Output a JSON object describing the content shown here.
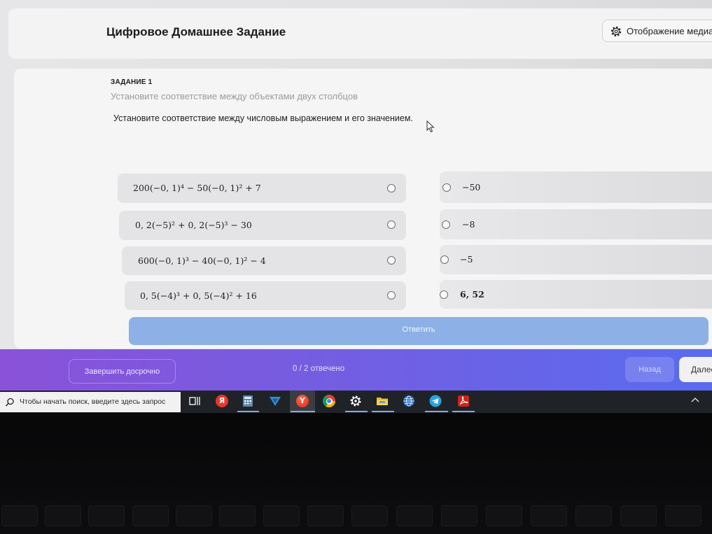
{
  "app": {
    "title": "Цифровое Домашнее Задание",
    "media_button_label": "Отображение медиа",
    "media_button_icon": "gear-icon"
  },
  "task": {
    "number_label": "ЗАДАНИЕ 1",
    "type_hint": "Установите соответствие между объектами двух столбцов",
    "question": "Установите соответствие между числовым выражением и его значением."
  },
  "left_items": [
    {
      "expression": "200(−0, 1)⁴ − 50(−0, 1)² + 7"
    },
    {
      "expression": "0, 2(−5)² + 0, 2(−5)³ − 30"
    },
    {
      "expression": "600(−0, 1)³ − 40(−0, 1)² − 4"
    },
    {
      "expression": "0, 5(−4)³ + 0, 5(−4)² + 16"
    }
  ],
  "right_items": [
    {
      "value": "−50"
    },
    {
      "value": "−8"
    },
    {
      "value": "−5"
    },
    {
      "value": "6, 52"
    }
  ],
  "answer_button_label": "Ответить",
  "footer": {
    "finish_early_label": "Завершить досрочно",
    "progress_text": "0 / 2 отвечено",
    "back_label": "Назад",
    "next_label": "Далее"
  },
  "taskbar": {
    "search_placeholder": "Чтобы начать поиск, введите здесь запрос",
    "apps": [
      {
        "icon": "task-view-icon"
      },
      {
        "icon": "yandex-icon",
        "glyph": "Я"
      },
      {
        "icon": "calculator-icon"
      },
      {
        "icon": "v-app-icon"
      },
      {
        "icon": "yandex-browser-icon",
        "glyph": "Y"
      },
      {
        "icon": "chrome-icon"
      },
      {
        "icon": "settings-icon"
      },
      {
        "icon": "file-explorer-icon"
      },
      {
        "icon": "globe-icon"
      },
      {
        "icon": "telegram-icon"
      },
      {
        "icon": "acrobat-icon"
      }
    ],
    "tray_icon": "chevron-up-icon"
  },
  "colors": {
    "answer_button": "#8db1e6",
    "footer_start": "#8a52d8",
    "footer_end": "#5a6bee",
    "taskbar": "#1f2327"
  }
}
